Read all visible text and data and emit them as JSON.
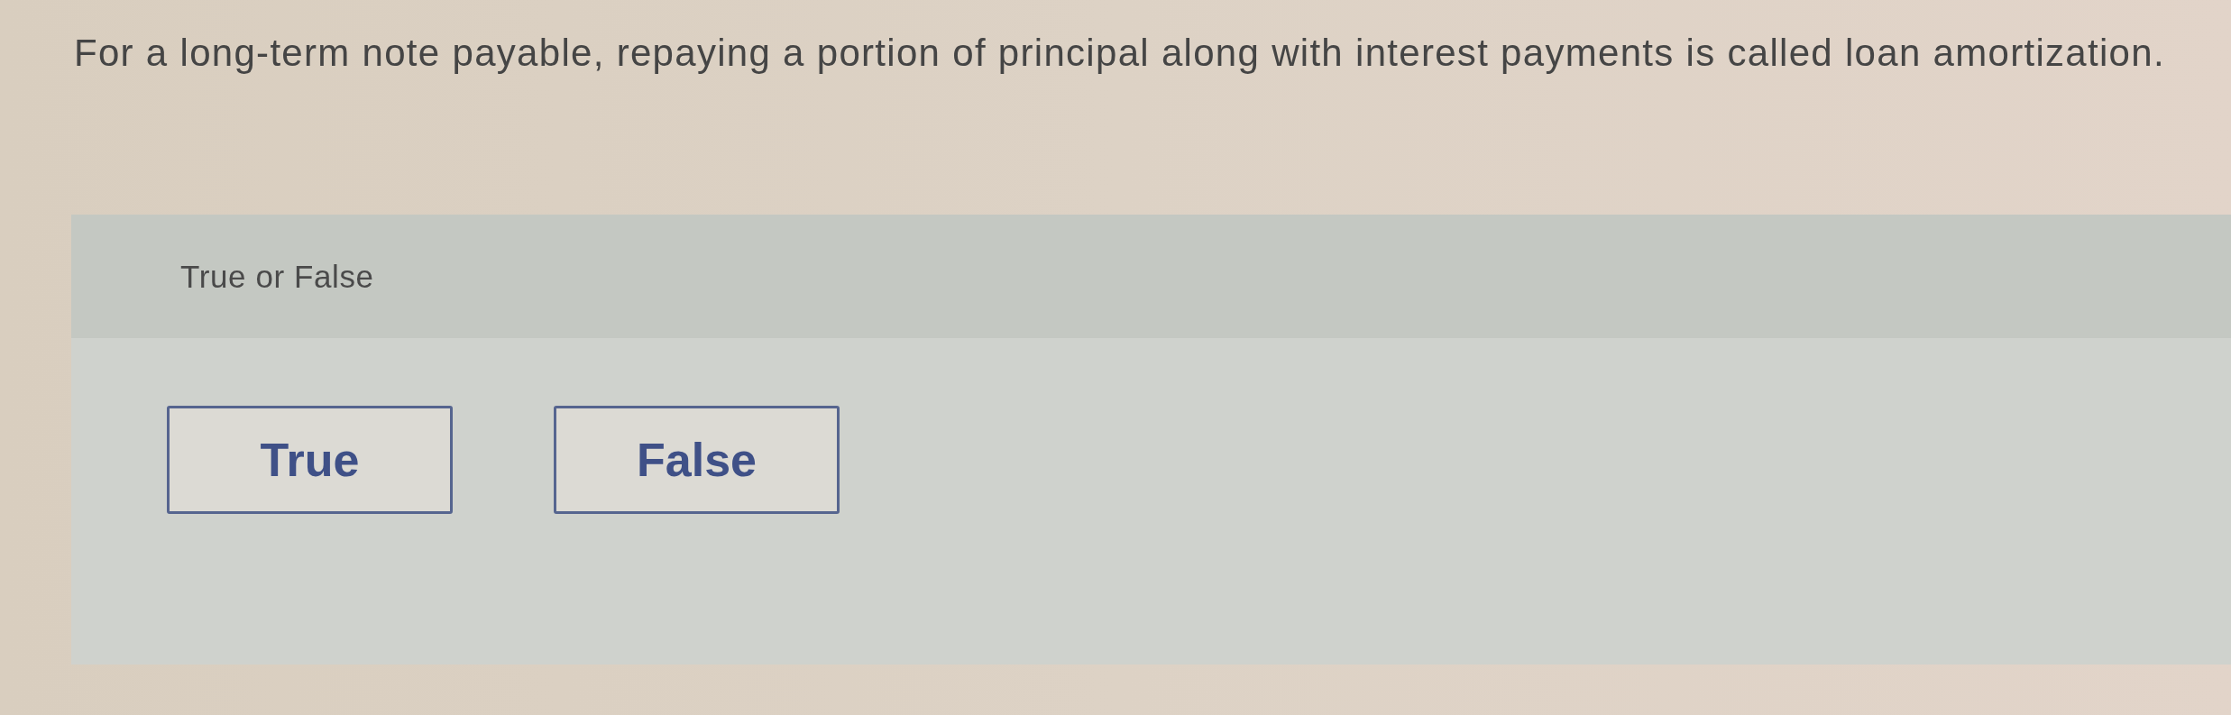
{
  "question": {
    "text": "For a long-term note payable, repaying a portion of principal along with interest payments is called loan amortization."
  },
  "answer_panel": {
    "prompt": "True or False",
    "options": [
      {
        "label": "True",
        "selected": false
      },
      {
        "label": "False",
        "selected": false
      }
    ]
  }
}
